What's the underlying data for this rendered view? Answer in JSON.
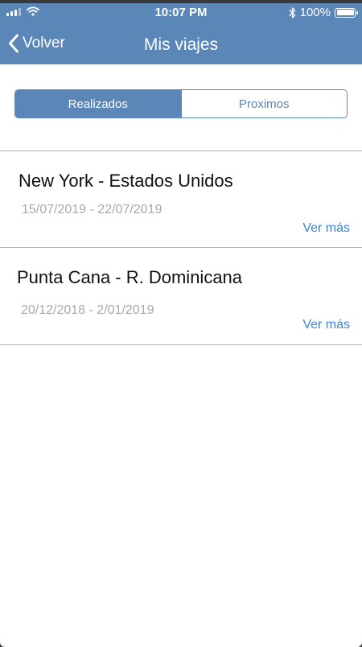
{
  "status_bar": {
    "time": "10:07 PM",
    "battery": "100%",
    "battery_level": 1.0,
    "icons": [
      "signal-icon",
      "wifi-icon",
      "bluetooth-icon",
      "battery-icon"
    ]
  },
  "nav": {
    "back_label": "Volver",
    "title": "Mis viajes"
  },
  "segments": {
    "items": [
      {
        "label": "Realizados",
        "selected": true
      },
      {
        "label": "Proximos",
        "selected": false
      }
    ]
  },
  "trips": [
    {
      "title": "New York - Estados Unidos",
      "dates": "15/07/2019 - 22/07/2019",
      "more": "Ver más"
    },
    {
      "title": "Punta Cana - R. Dominicana",
      "dates": "20/12/2018 - 2/01/2019",
      "more": "Ver más"
    }
  ],
  "colors": {
    "header": "#5a86b8",
    "accent_link": "#3b86d6",
    "muted_text": "#a9a9a9"
  }
}
